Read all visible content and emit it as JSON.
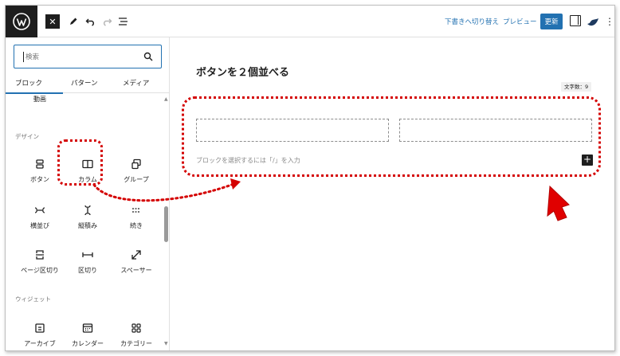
{
  "toolbar": {
    "close_icon": "✕",
    "tools_icon": "pencil-icon",
    "undo_icon": "undo-icon",
    "redo_icon": "redo-icon",
    "list_view_icon": "list-view-icon",
    "save_draft_label": "下書きへ切り替え",
    "preview_label": "プレビュー",
    "update_label": "更新",
    "more_icon": "⋮"
  },
  "inserter": {
    "search_placeholder": "検索",
    "tabs": [
      "ブロック",
      "パターン",
      "メディア"
    ],
    "active_tab": "ブロック",
    "top_item": "動画",
    "sections": [
      {
        "title": "デザイン",
        "items": [
          {
            "label": "ボタン",
            "icon": "buttons-icon"
          },
          {
            "label": "カラム",
            "icon": "columns-icon"
          },
          {
            "label": "グループ",
            "icon": "group-icon"
          },
          {
            "label": "横並び",
            "icon": "row-icon"
          },
          {
            "label": "縦積み",
            "icon": "stack-icon"
          },
          {
            "label": "続き",
            "icon": "more-icon"
          },
          {
            "label": "ページ区切り",
            "icon": "page-break-icon"
          },
          {
            "label": "区切り",
            "icon": "separator-icon"
          },
          {
            "label": "スペーサー",
            "icon": "spacer-icon"
          }
        ]
      },
      {
        "title": "ウィジェット",
        "items": [
          {
            "label": "アーカイブ",
            "icon": "archive-icon"
          },
          {
            "label": "カレンダー",
            "icon": "calendar-icon"
          },
          {
            "label": "カテゴリー",
            "icon": "categories-icon"
          }
        ]
      }
    ]
  },
  "editor": {
    "title": "ボタンを２個並べる",
    "word_count": "文字数：9",
    "block_placeholder": "ブロックを選択するには「/」を入力",
    "add_block_icon": "+"
  },
  "colors": {
    "accent": "#2271b1",
    "annotation": "#d40000",
    "dark": "#1e1e1e"
  }
}
